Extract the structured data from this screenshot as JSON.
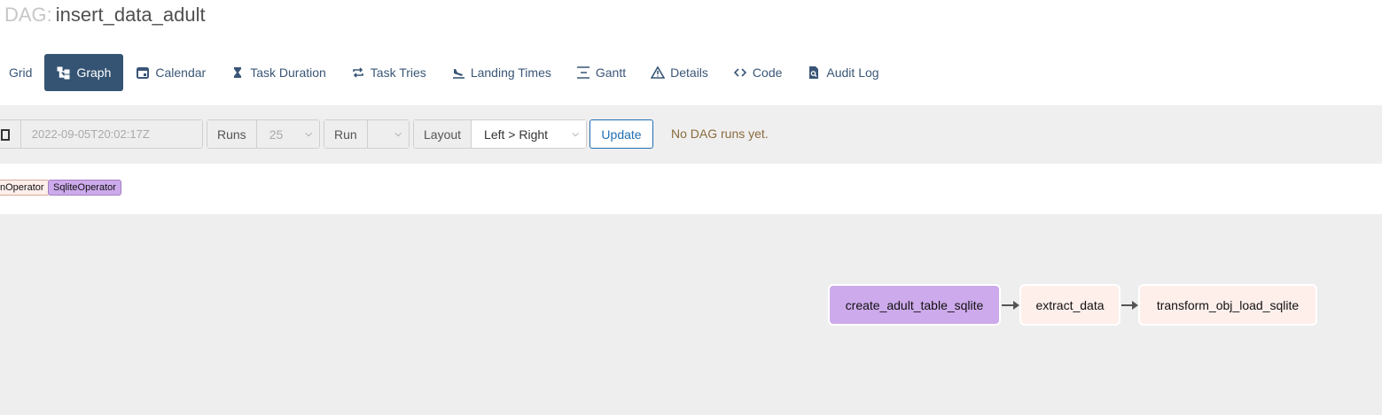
{
  "header": {
    "dag_label": "DAG:",
    "dag_id": "insert_data_adult"
  },
  "tabs": [
    {
      "label": "Grid",
      "icon": "grid-icon"
    },
    {
      "label": "Graph",
      "icon": "graph-icon",
      "active": true
    },
    {
      "label": "Calendar",
      "icon": "calendar-icon"
    },
    {
      "label": "Task Duration",
      "icon": "hourglass-icon"
    },
    {
      "label": "Task Tries",
      "icon": "repeat-icon"
    },
    {
      "label": "Landing Times",
      "icon": "plane-landing-icon"
    },
    {
      "label": "Gantt",
      "icon": "gantt-icon"
    },
    {
      "label": "Details",
      "icon": "warning-triangle-icon"
    },
    {
      "label": "Code",
      "icon": "code-icon"
    },
    {
      "label": "Audit Log",
      "icon": "file-search-icon"
    }
  ],
  "toolbar": {
    "base_date": "2022-09-05T20:02:17Z",
    "runs_label": "Runs",
    "runs_value": "25",
    "run_label": "Run",
    "run_value": "",
    "layout_label": "Layout",
    "layout_value": "Left > Right",
    "update_label": "Update",
    "status_text": "No DAG runs yet."
  },
  "legend": [
    {
      "label": "nOperator",
      "color": "#ffefeb"
    },
    {
      "label": "SqliteOperator",
      "color": "#cdaaeb"
    }
  ],
  "graph": {
    "nodes": [
      {
        "label": "create_adult_table_sqlite",
        "color": "#cdaaeb"
      },
      {
        "label": "extract_data",
        "color": "#ffefeb"
      },
      {
        "label": "transform_obj_load_sqlite",
        "color": "#ffefeb"
      }
    ]
  },
  "colors": {
    "accent": "#355473",
    "link": "#1f6fb2",
    "graph_bg": "#eeeeee"
  }
}
